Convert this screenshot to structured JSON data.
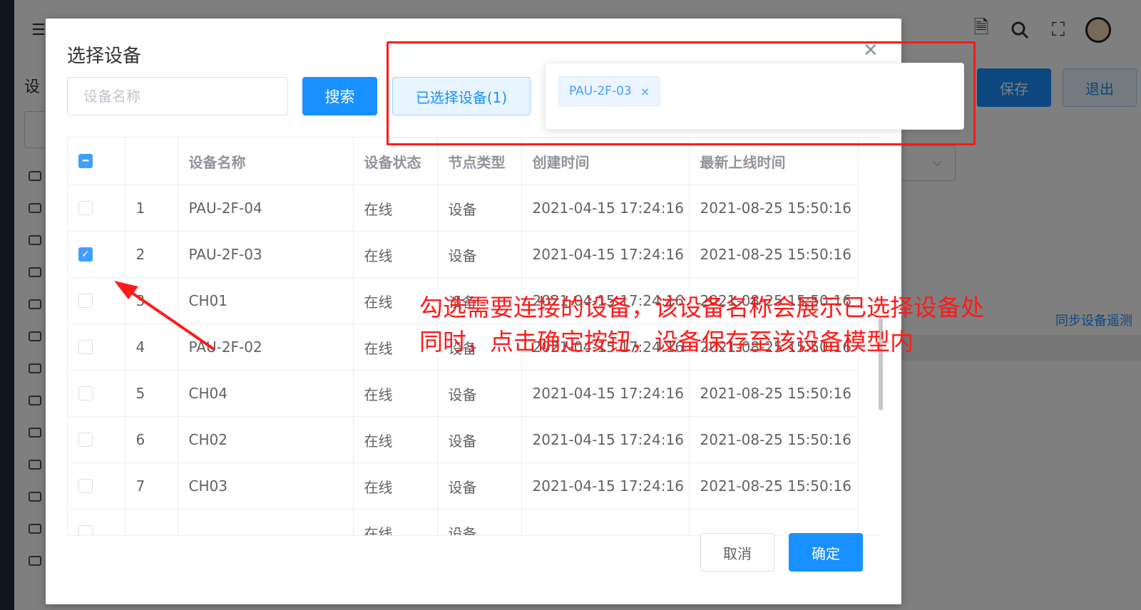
{
  "background": {
    "menu_icon": "menu-icon",
    "page_title_partial": "设",
    "save_label": "保存",
    "exit_label": "退出",
    "sync_link": "同步设备遥测"
  },
  "dialog": {
    "title": "选择设备",
    "search_placeholder": "设备名称",
    "search_button": "搜索",
    "selected_button": "已选择设备(1)",
    "selected_tags": [
      "PAU-2F-03"
    ],
    "cancel_label": "取消",
    "confirm_label": "确定"
  },
  "table": {
    "headers": [
      "",
      "",
      "设备名称",
      "设备状态",
      "节点类型",
      "创建时间",
      "最新上线时间"
    ],
    "rows": [
      {
        "index": "1",
        "name": "PAU-2F-04",
        "status": "在线",
        "type": "设备",
        "created": "2021-04-15 17:24:16",
        "online": "2021-08-25 15:50:16",
        "checked": false
      },
      {
        "index": "2",
        "name": "PAU-2F-03",
        "status": "在线",
        "type": "设备",
        "created": "2021-04-15 17:24:16",
        "online": "2021-08-25 15:50:16",
        "checked": true
      },
      {
        "index": "3",
        "name": "CH01",
        "status": "在线",
        "type": "设备",
        "created": "2021-04-15 17:24:16",
        "online": "2021-08-25 15:50:16",
        "checked": false
      },
      {
        "index": "4",
        "name": "PAU-2F-02",
        "status": "在线",
        "type": "设备",
        "created": "2021-04-15 17:24:16",
        "online": "2021-08-25 15:50:16",
        "checked": false
      },
      {
        "index": "5",
        "name": "CH04",
        "status": "在线",
        "type": "设备",
        "created": "2021-04-15 17:24:16",
        "online": "2021-08-25 15:50:16",
        "checked": false
      },
      {
        "index": "6",
        "name": "CH02",
        "status": "在线",
        "type": "设备",
        "created": "2021-04-15 17:24:16",
        "online": "2021-08-25 15:50:16",
        "checked": false
      },
      {
        "index": "7",
        "name": "CH03",
        "status": "在线",
        "type": "设备",
        "created": "2021-04-15 17:24:16",
        "online": "2021-08-25 15:50:16",
        "checked": false
      },
      {
        "index": "",
        "name": "",
        "status": "在线",
        "type": "设备",
        "created": "",
        "online": "",
        "checked": false
      }
    ]
  },
  "annotation": {
    "line1": "勾选需要连接的设备，该设备名称会展示已选择设备处",
    "line2": "同时，点击确定按钮，设备保存至该设备模型内",
    "color": "#ff1a1a"
  },
  "colors": {
    "primary": "#1890ff",
    "primary_light": "#e8f4ff",
    "annotation_red": "#ff1a1a"
  }
}
